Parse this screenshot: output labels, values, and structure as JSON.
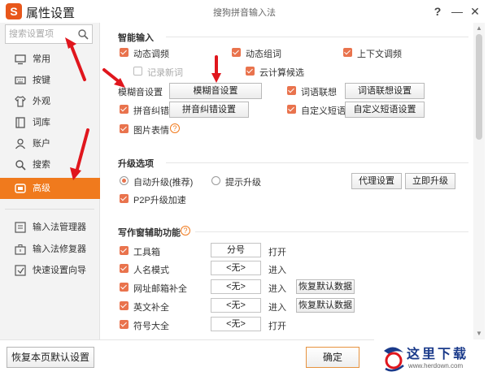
{
  "window": {
    "logo": "S",
    "title": "属性设置",
    "center_title": "搜狗拼音输入法",
    "help": "?",
    "minimize": "—",
    "close": "✕"
  },
  "sidebar": {
    "search_placeholder": "搜索设置项",
    "items": [
      {
        "label": "常用",
        "icon": "monitor-icon"
      },
      {
        "label": "按键",
        "icon": "keyboard-icon"
      },
      {
        "label": "外观",
        "icon": "shirt-icon"
      },
      {
        "label": "词库",
        "icon": "book-icon"
      },
      {
        "label": "账户",
        "icon": "user-icon"
      },
      {
        "label": "搜索",
        "icon": "search-icon"
      },
      {
        "label": "高级",
        "icon": "advanced-icon"
      }
    ],
    "tools": [
      {
        "label": "输入法管理器",
        "icon": "list-icon"
      },
      {
        "label": "输入法修复器",
        "icon": "toolbox-icon"
      },
      {
        "label": "快速设置向导",
        "icon": "wizard-icon"
      }
    ]
  },
  "smart_input": {
    "title": "智能输入",
    "options": {
      "dynamic_freq": "动态调频",
      "dynamic_phrase": "动态组词",
      "context_freq": "上下文调频",
      "record_new_words": "记录新词",
      "cloud_candidate": "云计算候选",
      "fuzzy_label": "模糊音设置",
      "fuzzy_button": "模糊音设置",
      "association": "词语联想",
      "association_button": "词语联想设置",
      "pinyin_correction": "拼音纠错",
      "pinyin_correction_button": "拼音纠错设置",
      "custom_phrase": "自定义短语",
      "custom_phrase_button": "自定义短语设置",
      "picture_expression": "图片表情"
    }
  },
  "upgrade": {
    "title": "升级选项",
    "auto": "自动升级(推荐)",
    "prompt": "提示升级",
    "proxy_button": "代理设置",
    "upgrade_now_button": "立即升级",
    "p2p": "P2P升级加速"
  },
  "writing": {
    "title": "写作窗辅助功能",
    "rows": [
      {
        "label": "工具箱",
        "value": "分号",
        "action": "打开",
        "button": ""
      },
      {
        "label": "人名模式",
        "value": "<无>",
        "action": "进入",
        "button": ""
      },
      {
        "label": "网址邮箱补全",
        "value": "<无>",
        "action": "进入",
        "button": "恢复默认数据"
      },
      {
        "label": "英文补全",
        "value": "<无>",
        "action": "进入",
        "button": "恢复默认数据"
      },
      {
        "label": "符号大全",
        "value": "<无>",
        "action": "打开",
        "button": ""
      }
    ]
  },
  "footer": {
    "restore_defaults": "恢复本页默认设置",
    "ok": "确定"
  },
  "watermark": {
    "text": "这里下载",
    "url": "www.herdown.com"
  },
  "colors": {
    "accent": "#f07a1d",
    "checkbox": "#e9734d",
    "annotation": "#e0161d"
  }
}
